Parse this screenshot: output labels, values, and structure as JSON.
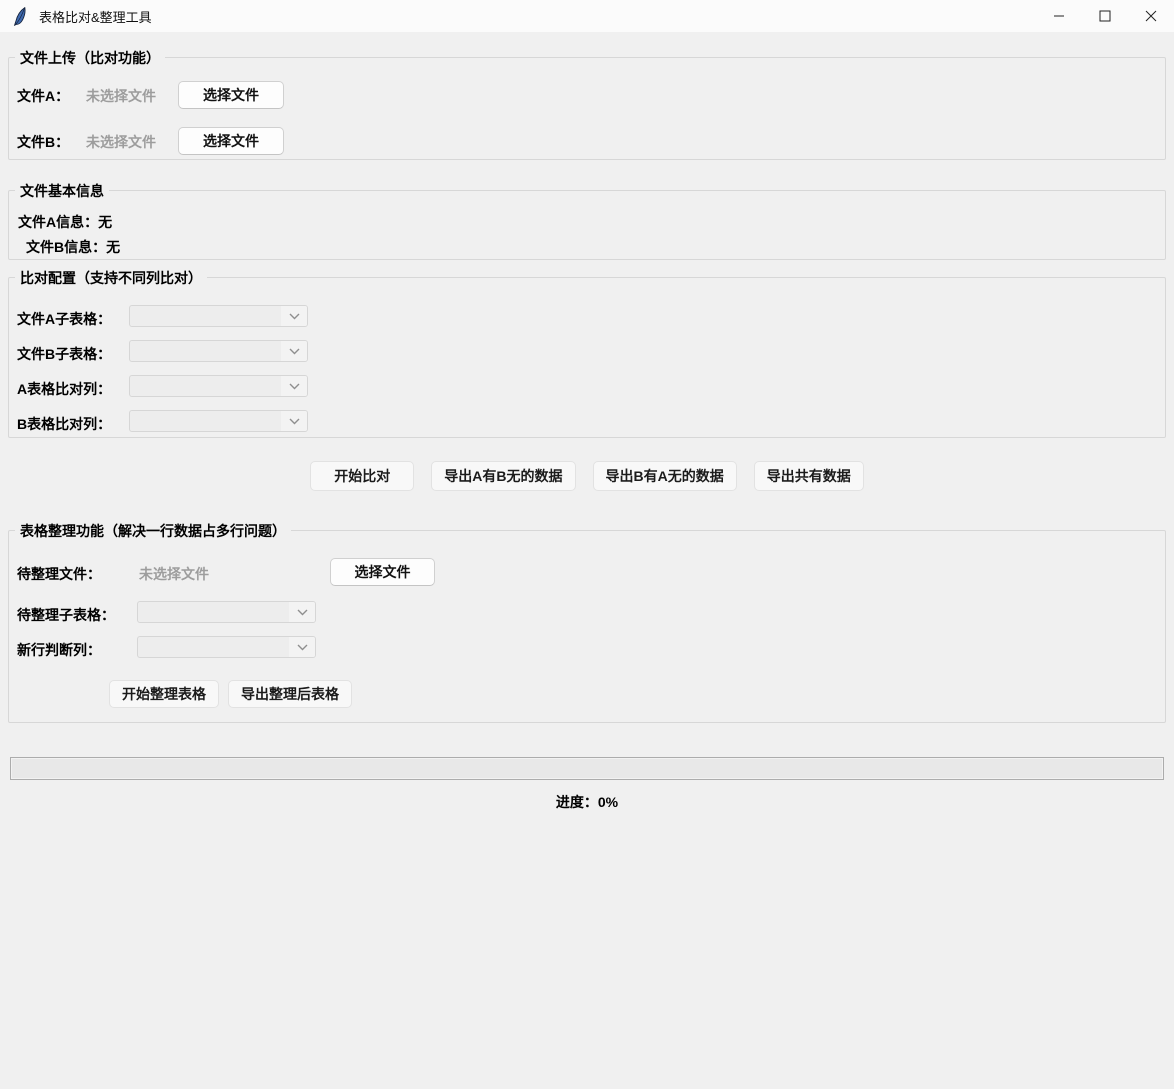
{
  "window": {
    "title": "表格比对&整理工具"
  },
  "upload_section": {
    "title": "文件上传（比对功能）",
    "rows": [
      {
        "label": "文件A：",
        "value": "未选择文件",
        "button": "选择文件"
      },
      {
        "label": "文件B：",
        "value": "未选择文件",
        "button": "选择文件"
      }
    ]
  },
  "info_section": {
    "title": "文件基本信息",
    "file_a_info": "文件A信息：无",
    "file_b_info": "文件B信息：无"
  },
  "compare_config_section": {
    "title": "比对配置（支持不同列比对）",
    "rows": [
      {
        "label": "文件A子表格：",
        "value": ""
      },
      {
        "label": "文件B子表格：",
        "value": ""
      },
      {
        "label": "A表格比对列：",
        "value": ""
      },
      {
        "label": "B表格比对列：",
        "value": ""
      }
    ]
  },
  "compare_actions": {
    "buttons": [
      "开始比对",
      "导出A有B无的数据",
      "导出B有A无的数据",
      "导出共有数据"
    ]
  },
  "organize_section": {
    "title": "表格整理功能（解决一行数据占多行问题）",
    "file_row": {
      "label": "待整理文件：",
      "value": "未选择文件",
      "button": "选择文件"
    },
    "rows": [
      {
        "label": "待整理子表格：",
        "value": ""
      },
      {
        "label": "新行判断列：",
        "value": ""
      }
    ],
    "buttons": [
      "开始整理表格",
      "导出整理后表格"
    ]
  },
  "progress": {
    "label": "进度：0%",
    "percent": 0,
    "bar_color": "#e8e8e8"
  }
}
